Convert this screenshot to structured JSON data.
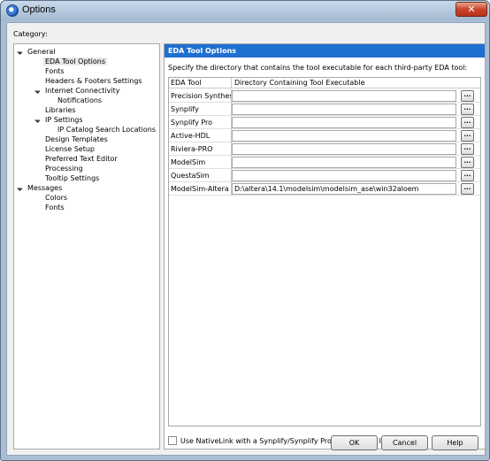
{
  "window": {
    "title": "Options",
    "close_glyph": "✕"
  },
  "category_label": "Category:",
  "tree": {
    "items": [
      {
        "label": "General",
        "expanded": true
      },
      {
        "label": "EDA Tool Options",
        "selected": true
      },
      {
        "label": "Fonts"
      },
      {
        "label": "Headers & Footers Settings"
      },
      {
        "label": "Internet Connectivity",
        "expanded": true
      },
      {
        "label": "Notifications"
      },
      {
        "label": "Libraries"
      },
      {
        "label": "IP Settings",
        "expanded": true
      },
      {
        "label": "IP Catalog Search Locations"
      },
      {
        "label": "Design Templates"
      },
      {
        "label": "License Setup"
      },
      {
        "label": "Preferred Text Editor"
      },
      {
        "label": "Processing"
      },
      {
        "label": "Tooltip Settings"
      },
      {
        "label": "Messages",
        "expanded": true
      },
      {
        "label": "Colors"
      },
      {
        "label": "Fonts"
      }
    ]
  },
  "panel": {
    "header": "EDA Tool Options",
    "description": "Specify the directory that contains the tool executable for each third-party EDA tool:",
    "columns": [
      "EDA Tool",
      "Directory Containing Tool Executable"
    ],
    "rows": [
      {
        "tool": "Precision Synthesis",
        "directory": ""
      },
      {
        "tool": "Synplify",
        "directory": ""
      },
      {
        "tool": "Synplify Pro",
        "directory": ""
      },
      {
        "tool": "Active-HDL",
        "directory": ""
      },
      {
        "tool": "Riviera-PRO",
        "directory": ""
      },
      {
        "tool": "ModelSim",
        "directory": ""
      },
      {
        "tool": "QuestaSim",
        "directory": ""
      },
      {
        "tool": "ModelSim-Altera",
        "directory": "D:\\altera\\14.1\\modelsim\\modelsim_ase\\win32aloem"
      }
    ],
    "browse_label": "...",
    "nativelink_label": "Use NativeLink with a Synplify/Synplify Pro node-locked license",
    "nativelink_checked": false
  },
  "buttons": {
    "ok": "OK",
    "cancel": "Cancel",
    "help": "Help"
  },
  "colors": {
    "header_bg": "#1f6fd1",
    "title_bar": "#a4bad2"
  },
  "icons": {
    "app": "options-app-icon",
    "close": "close-icon",
    "expand": "expanded-triangle-icon",
    "checkbox": "checkbox-icon"
  }
}
